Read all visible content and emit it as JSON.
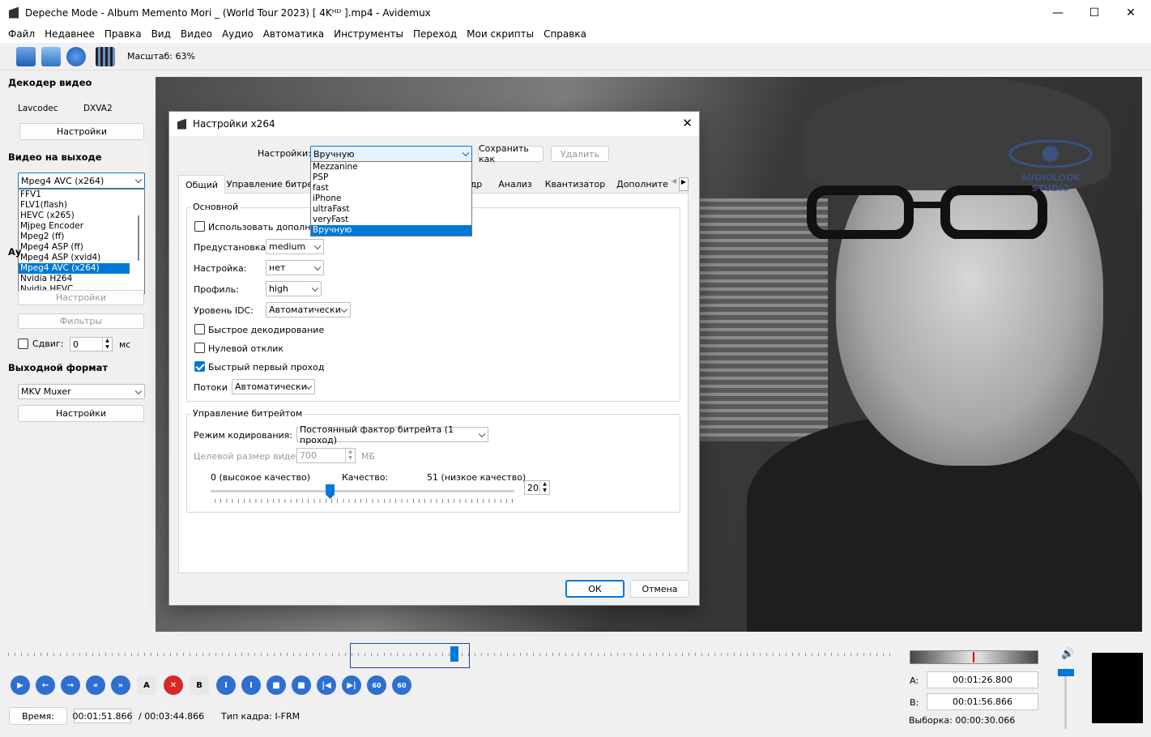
{
  "window": {
    "title": "Depeche Mode - Album Memento Mori _  (World Tour 2023) [ 4Kᴴᴰ ].mp4 - Avidemux",
    "minimize": "—",
    "maximize": "☐",
    "close": "✕"
  },
  "menu": [
    "Файл",
    "Недавнее",
    "Правка",
    "Вид",
    "Видео",
    "Аудио",
    "Автоматика",
    "Инструменты",
    "Переход",
    "Мои скрипты",
    "Справка"
  ],
  "toolbar": {
    "zoom": "Масштаб: 63%"
  },
  "left": {
    "decoder_title": "Декодер видео",
    "decoder_lib": "Lavcodec",
    "decoder_hw": "DXVA2",
    "decoder_settings": "Настройки",
    "video_out_title": "Видео на выходе",
    "video_out_value": "Mpeg4 AVC (x264)",
    "video_list": [
      "FFV1",
      "FLV1(flash)",
      "HEVC (x265)",
      "Mjpeg Encoder",
      "Mpeg2 (ff)",
      "Mpeg4 ASP (ff)",
      "Mpeg4 ASP (xvid4)",
      "Mpeg4 AVC (x264)",
      "Nvidia H264",
      "Nvidia HEVC"
    ],
    "audio_partial": "Ау",
    "audio_settings": "Настройки",
    "filters": "Фильтры",
    "shift_label": "Сдвиг:",
    "shift_value": "0",
    "shift_unit": "мс",
    "format_title": "Выходной формат",
    "format_value": "MKV Muxer",
    "format_settings": "Настройки"
  },
  "video": {
    "watermark1": "AUDIOLOOK",
    "watermark2": "STUDIO"
  },
  "dialog": {
    "title": "Настройки x264",
    "preset_label": "Настройки:",
    "preset_value": "Вручную",
    "save_as": "Сохранить как",
    "delete": "Удалить",
    "preset_list": [
      "Mezzanine",
      "PSP",
      "fast",
      "iPhone",
      "ultraFast",
      "veryFast",
      "Вручную"
    ],
    "tabs": [
      "Общий",
      "Управление битре",
      "др",
      "Анализ",
      "Квантизатор",
      "Дополните"
    ],
    "basic_title": "Основной",
    "use_advanced": "Использовать дополнит",
    "preset2_label": "Предустановка:",
    "preset2_value": "medium",
    "tune_label": "Настройка:",
    "tune_value": "нет",
    "profile_label": "Профиль:",
    "profile_value": "high",
    "idc_label": "Уровень IDC:",
    "idc_value": "Автоматически",
    "fast_decode": "Быстрое декодирование",
    "zero_latency": "Нулевой отклик",
    "fast_first_pass": "Быстрый первый проход",
    "threads_label": "Потоки",
    "threads_value": "Автоматически",
    "bitrate_title": "Управление битрейтом",
    "mode_label": "Режим кодирования:",
    "mode_value": "Постоянный фактор битрейта (1 проход)",
    "target_label": "Целевой размер видео:",
    "target_value": "700",
    "target_unit": "МБ",
    "q_low": "0 (высокое качество)",
    "q_label": "Качество:",
    "q_high": "51 (низкое качество)",
    "q_value": "20",
    "quality": 20,
    "quality_max": 51,
    "ok": "ОК",
    "cancel": "Отмена"
  },
  "bottom": {
    "time_label": "Время:",
    "time_value": "00:01:51.866",
    "duration": "/ 00:03:44.866",
    "frame_type": "Тип кадра:  I-FRM",
    "a_label": "A:",
    "a_value": "00:01:26.800",
    "b_label": "B:",
    "b_value": "00:01:56.866",
    "selection": "Выборка: 00:00:30.066",
    "ctrl": [
      "",
      "",
      "",
      "",
      "",
      "",
      "",
      "",
      "",
      "",
      "",
      "",
      "",
      "",
      "60",
      "60"
    ],
    "ab_a": "A",
    "ab_b": "B",
    "volume_icon": "🔊"
  },
  "colors": {
    "accent": "#0078d7",
    "ctrl": "#2f6fd0",
    "selection_box": "#1f3fb0"
  }
}
